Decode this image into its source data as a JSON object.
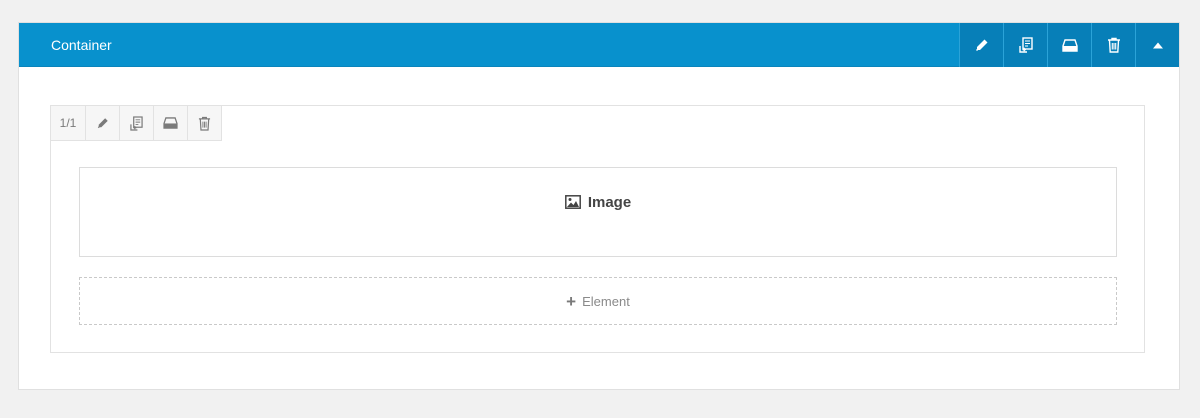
{
  "container": {
    "title": "Container",
    "tools": [
      {
        "icon": "pencil-icon",
        "action": "edit"
      },
      {
        "icon": "duplicate-icon",
        "action": "duplicate"
      },
      {
        "icon": "save-icon",
        "action": "save"
      },
      {
        "icon": "trash-icon",
        "action": "delete"
      },
      {
        "icon": "caret-up-icon",
        "action": "collapse"
      }
    ]
  },
  "column": {
    "size_label": "1/1",
    "tools": [
      {
        "icon": "pencil-icon"
      },
      {
        "icon": "duplicate-icon"
      },
      {
        "icon": "save-icon"
      },
      {
        "icon": "trash-icon"
      }
    ]
  },
  "elements": [
    {
      "type": "image",
      "icon": "image-icon",
      "label": "Image"
    }
  ],
  "add_element": {
    "icon": "plus-icon",
    "label": "Element"
  },
  "colors": {
    "header": "#0891cd",
    "header_tool": "#077fb8",
    "background": "#f1f1f1"
  }
}
